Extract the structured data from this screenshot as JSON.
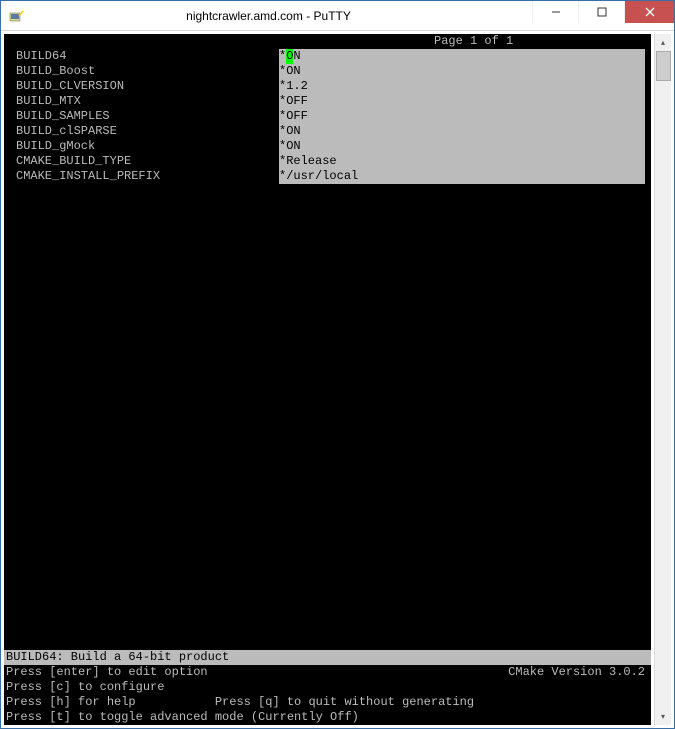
{
  "window": {
    "title": "nightcrawler.amd.com - PuTTY"
  },
  "page_indicator": "Page 1 of 1",
  "options": [
    {
      "name": "BUILD64",
      "value": "ON",
      "selected": true
    },
    {
      "name": "BUILD_Boost",
      "value": "ON",
      "selected": false
    },
    {
      "name": "BUILD_CLVERSION",
      "value": "1.2",
      "selected": false
    },
    {
      "name": "BUILD_MTX",
      "value": "OFF",
      "selected": false
    },
    {
      "name": "BUILD_SAMPLES",
      "value": "OFF",
      "selected": false
    },
    {
      "name": "BUILD_clSPARSE",
      "value": "ON",
      "selected": false
    },
    {
      "name": "BUILD_gMock",
      "value": "ON",
      "selected": false
    },
    {
      "name": "CMAKE_BUILD_TYPE",
      "value": "Release",
      "selected": false
    },
    {
      "name": "CMAKE_INSTALL_PREFIX",
      "value": "/usr/local",
      "selected": false
    }
  ],
  "status": "BUILD64: Build a 64-bit product",
  "help": {
    "line1_left": "Press [enter] to edit option",
    "line1_right": "CMake Version 3.0.2",
    "line2": "Press [c] to configure",
    "line3": "Press [h] for help           Press [q] to quit without generating",
    "line4": "Press [t] to toggle advanced mode (Currently Off)"
  }
}
